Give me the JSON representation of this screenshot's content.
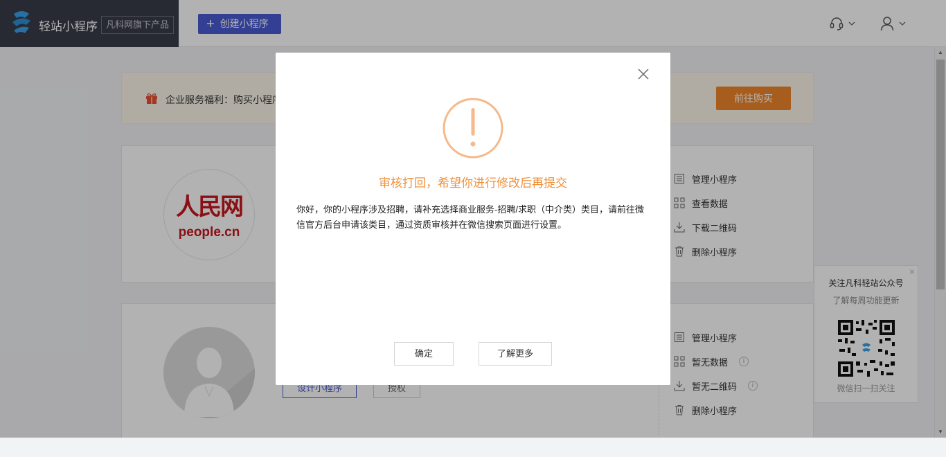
{
  "header": {
    "app_name": "轻站小程序",
    "sub_brand": "凡科网旗下产品",
    "create_button": "创建小程序"
  },
  "banner": {
    "text": "企业服务福利：购买小程序",
    "buy_button": "前往购买"
  },
  "cards": [
    {
      "logo_text_top": "人民网",
      "logo_text_bottom": "people.cn",
      "ops": [
        "管理小程序",
        "查看数据",
        "下载二维码",
        "删除小程序"
      ]
    },
    {
      "buttons": [
        "设计小程序",
        "授权"
      ],
      "ops": [
        "管理小程序",
        "暂无数据",
        "暂无二维码",
        "删除小程序"
      ]
    }
  ],
  "follow_panel": {
    "title": "关注凡科轻站公众号",
    "subtitle": "了解每周功能更新",
    "footer": "微信扫一扫关注"
  },
  "modal": {
    "title": "审核打回，希望你进行修改后再提交",
    "body": "你好，你的小程序涉及招聘，请补充选择商业服务-招聘/求职（中介类）类目，请前往微信官方后台申请该类目，通过资质审核并在微信搜索页面进行设置。",
    "confirm_button": "确定",
    "learn_more_button": "了解更多"
  },
  "colors": {
    "accent_blue": "#4a5bd3",
    "warning_orange": "#f0903a",
    "buy_orange": "#f0862a",
    "header_dark": "#393d49"
  }
}
